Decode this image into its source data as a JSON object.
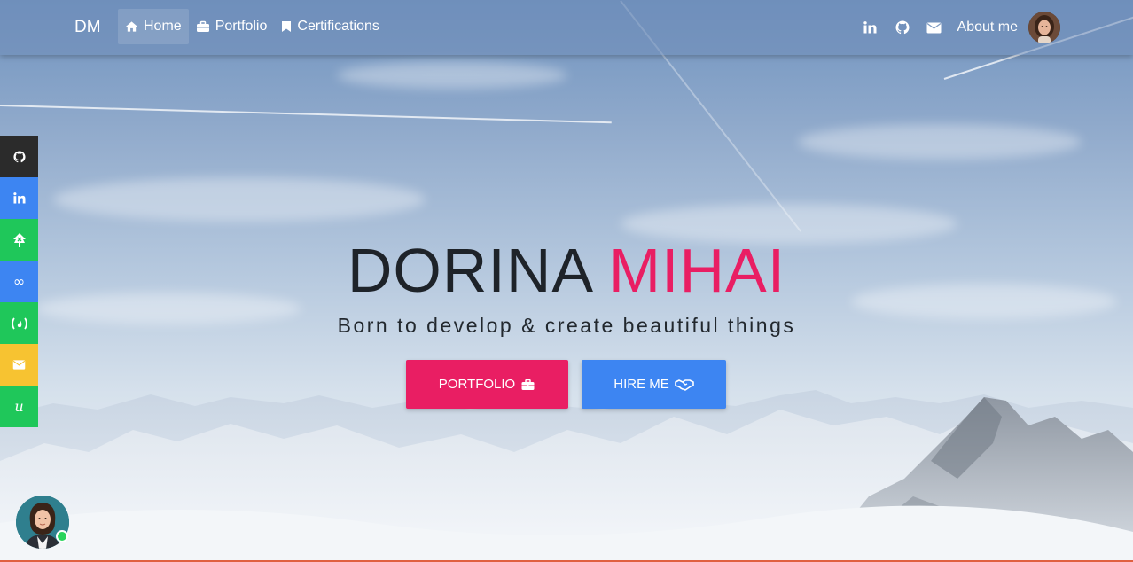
{
  "navbar": {
    "brand": "DM",
    "items": [
      {
        "label": "Home",
        "icon": "home-icon",
        "active": true
      },
      {
        "label": "Portfolio",
        "icon": "briefcase-icon",
        "active": false
      },
      {
        "label": "Certifications",
        "icon": "bookmark-icon",
        "active": false
      }
    ],
    "right_icons": [
      "linkedin-icon",
      "github-icon",
      "envelope-icon"
    ],
    "about_label": "About me"
  },
  "sidebar": {
    "items": [
      {
        "icon": "github-icon",
        "color": "#2b2b2b"
      },
      {
        "icon": "linkedin-icon",
        "color": "#3d85f2"
      },
      {
        "icon": "treehouse-icon",
        "color": "#1fc75a"
      },
      {
        "icon": "infinity-icon",
        "color": "#3d85f2"
      },
      {
        "icon": "freecodecamp-icon",
        "color": "#1fc75a"
      },
      {
        "icon": "envelope-icon",
        "color": "#f7c331"
      },
      {
        "icon": "udemy-icon",
        "color": "#1fc75a"
      }
    ]
  },
  "hero": {
    "first_name": "DORINA",
    "last_name": "MIHAI",
    "tagline": "Born to develop & create beautiful things",
    "buttons": {
      "portfolio_label": "PORTFOLIO",
      "hire_label": "HIRE ME"
    }
  },
  "colors": {
    "accent_pink": "#e91e63",
    "accent_blue": "#3d85f2",
    "online_green": "#29d45c"
  }
}
